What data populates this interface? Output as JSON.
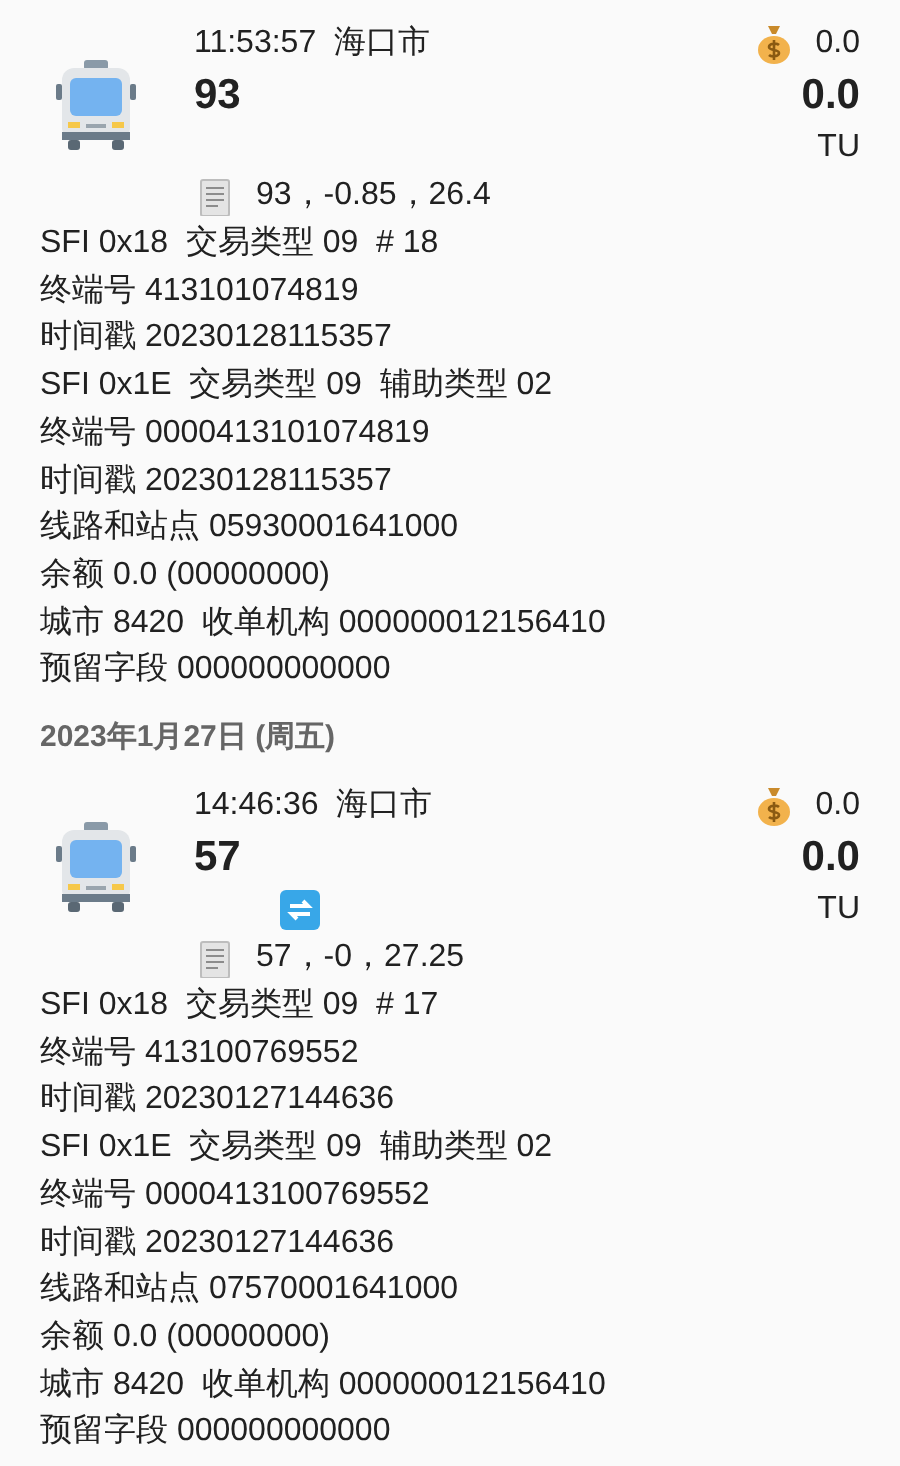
{
  "records": [
    {
      "time": "11:53:57",
      "city": "海口市",
      "route": "93",
      "balance": "0.0",
      "amount": "0.0",
      "unit": "TU",
      "memo": "93，-0.85，26.4",
      "lines": [
        "SFI 0x18  交易类型 09  # 18",
        "终端号 413101074819",
        "时间戳 20230128115357",
        "SFI 0x1E  交易类型 09  辅助类型 02",
        "终端号 0000413101074819",
        "时间戳 20230128115357",
        "线路和站点 05930001641000",
        "余额 0.0 (00000000)",
        "城市 8420  收单机构 000000012156410",
        "预留字段 000000000000"
      ]
    },
    {
      "date": "2023年1月27日 (周五)",
      "time": "14:46:36",
      "city": "海口市",
      "route": "57",
      "balance": "0.0",
      "amount": "0.0",
      "unit": "TU",
      "transfer": true,
      "memo": "57，-0，27.25",
      "lines": [
        "SFI 0x18  交易类型 09  # 17",
        "终端号 413100769552",
        "时间戳 20230127144636",
        "SFI 0x1E  交易类型 09  辅助类型 02",
        "终端号 0000413100769552",
        "时间戳 20230127144636",
        "线路和站点 07570001641000",
        "余额 0.0 (00000000)",
        "城市 8420  收单机构 000000012156410",
        "预留字段 000000000000"
      ]
    }
  ]
}
